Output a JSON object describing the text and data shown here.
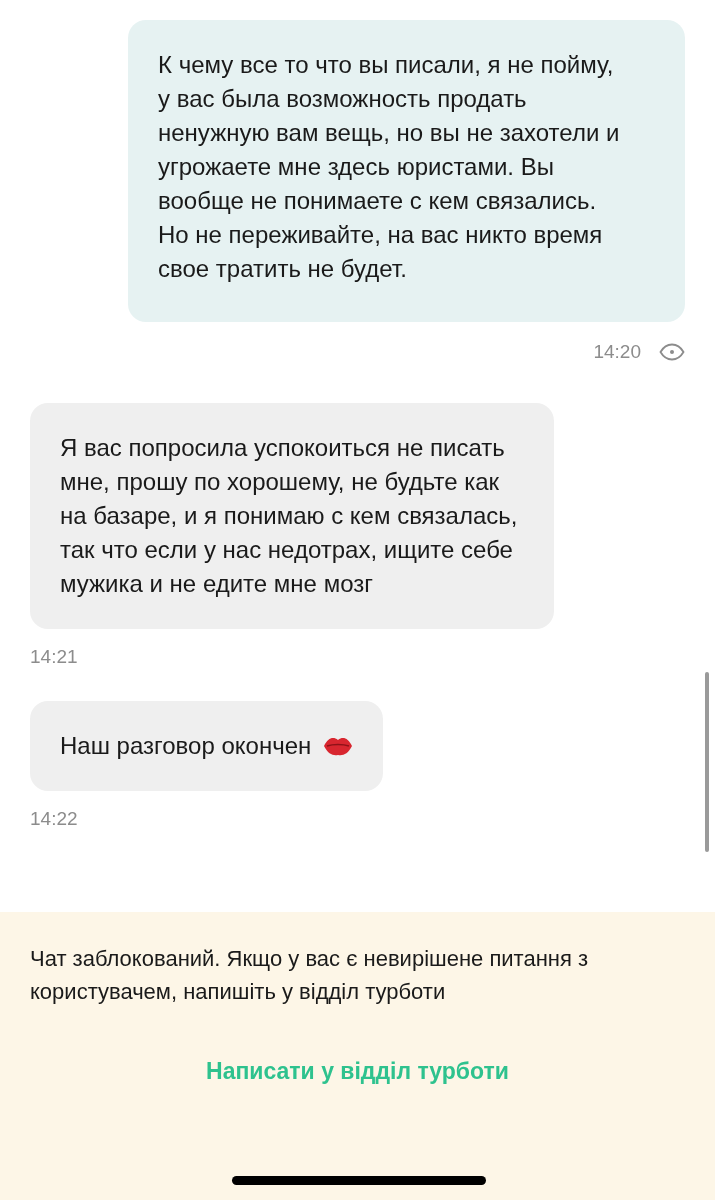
{
  "messages": [
    {
      "outgoing": true,
      "kind": "plain",
      "text": "К чему все то что вы писали, я не пойму, у вас была возможность продать ненужную вам вещь, но вы не захотели и угрожаете мне здесь юристами. Вы вообще не понимаете с кем связались. Но не переживайте, на вас никто время свое тратить не будет.",
      "time": "14:20",
      "seen": true
    },
    {
      "outgoing": false,
      "kind": "plain",
      "text": "Я вас попросила успокоиться не писать мне, прошу по хорошему, не будьте как на базаре, и я понимаю с кем связалась, так что если у нас недотрах, ищите себе мужика и не едите мне мозг",
      "time": "14:21"
    },
    {
      "outgoing": false,
      "kind": "with-icon",
      "text": "Наш разговор окончен",
      "time": "14:22"
    }
  ],
  "blocked_notice": {
    "text": "Чат заблокований. Якщо у вас є невирішене питання з користувачем, напишіть у відділ турботи",
    "link": "Написати у відділ турботи"
  }
}
